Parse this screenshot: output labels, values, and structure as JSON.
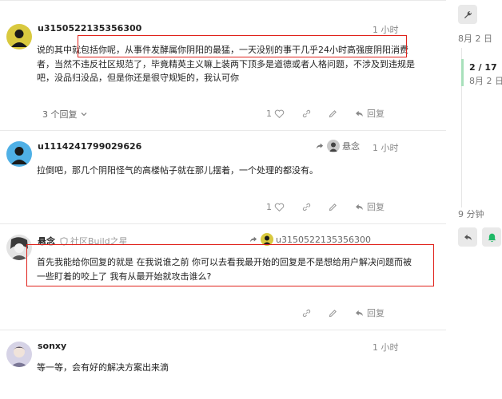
{
  "posts": [
    {
      "username": "u3150522135356300",
      "date": "1 小时",
      "lines": [
        "说的其中就包括你呢，从事件发酵属你阴阳的最猛，一天没别的事干几乎24小时高强度阴阳消费",
        "者，当然不违反社区规范了，毕竟精英主义嘛上装两下顶多是道德或者人格问题，不涉及到违规是",
        "吧，没品归没品，但是你还是很守规矩的，我认可你"
      ],
      "replies_label": "3 个回复",
      "like_count": "1",
      "reply_label": "回复",
      "avatar_color": "#d9c93f"
    },
    {
      "username": "u1114241799029626",
      "date": "1 小时",
      "reply_to": "悬念",
      "lines": [
        "拉倒吧，那几个阴阳怪气的高楼帖子就在那儿摆着，一个处理的都没有。"
      ],
      "like_count": "1",
      "reply_label": "回复",
      "avatar_color": "#4fb0e6"
    },
    {
      "username": "悬念",
      "flair": "社区Build之星",
      "reply_to": "u3150522135356300",
      "lines": [
        "首先我能给你回复的就是 在我说谁之前 你可以去看我最开始的回复是不是想给用户解决问题而被",
        "一些盯着的咬上了 我有从最开始就攻击谁么?"
      ],
      "reply_label": "回复"
    },
    {
      "username": "sonxy",
      "date": "1 小时",
      "lines": [
        "等一等，会有好的解决方案出来滴"
      ]
    }
  ],
  "timeline": {
    "top_date": "8月 2 日",
    "position": "2 / 17",
    "position_date": "8月 2 日",
    "ago": "9 分钟"
  },
  "colors": {
    "highlight": "#e0231c",
    "timeline_bar": "#a8e0bb",
    "accent_green": "#1fb866"
  },
  "icons": [
    "wrench-icon",
    "heart-icon",
    "link-icon",
    "reply-icon",
    "chevron-down-icon",
    "pencil-icon",
    "shield-icon",
    "share-reply-icon",
    "bell-icon"
  ]
}
